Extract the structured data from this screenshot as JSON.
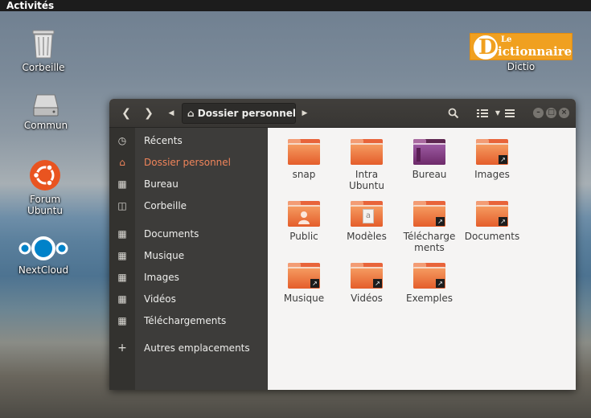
{
  "topbar": {
    "activities": "Activités"
  },
  "desktop": {
    "icons": [
      {
        "label": "Corbeille"
      },
      {
        "label": "Commun"
      },
      {
        "label": "Forum\nUbuntu",
        "line1": "Forum",
        "line2": "Ubuntu"
      },
      {
        "label": "NextCloud"
      }
    ],
    "dictio": {
      "le": "Le",
      "word": "ictionnaire",
      "letter": "D",
      "label": "Dictio"
    }
  },
  "window": {
    "path": "Dossier personnel",
    "sidebar": [
      {
        "label": "Récents",
        "icon": "clock-icon"
      },
      {
        "label": "Dossier personnel",
        "icon": "home-icon",
        "active": true
      },
      {
        "label": "Bureau",
        "icon": "folder-icon"
      },
      {
        "label": "Corbeille",
        "icon": "trash-icon"
      },
      {
        "label": "Documents",
        "icon": "folder-icon"
      },
      {
        "label": "Musique",
        "icon": "folder-icon"
      },
      {
        "label": "Images",
        "icon": "folder-icon"
      },
      {
        "label": "Vidéos",
        "icon": "folder-icon"
      },
      {
        "label": "Téléchargements",
        "icon": "folder-icon"
      },
      {
        "label": "Autres emplacements",
        "icon": "plus-icon"
      }
    ],
    "files": [
      {
        "line1": "snap",
        "line2": ""
      },
      {
        "line1": "Intra",
        "line2": "Ubuntu"
      },
      {
        "line1": "Bureau",
        "line2": ""
      },
      {
        "line1": "Images",
        "line2": ""
      },
      {
        "line1": "Public",
        "line2": ""
      },
      {
        "line1": "Modèles",
        "line2": ""
      },
      {
        "line1": "Télécharge",
        "line2": "ments"
      },
      {
        "line1": "Documents",
        "line2": ""
      },
      {
        "line1": "Musique",
        "line2": ""
      },
      {
        "line1": "Vidéos",
        "line2": ""
      },
      {
        "line1": "Exemples",
        "line2": ""
      }
    ]
  },
  "colors": {
    "accent": "#f0845a",
    "folder": "#e8643a",
    "headerbar": "#3d3c3a"
  }
}
